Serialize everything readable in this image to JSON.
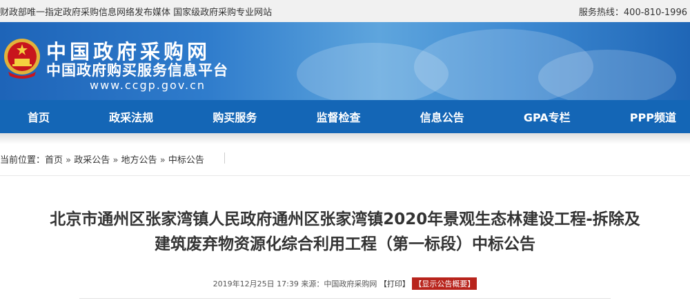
{
  "topbar": {
    "left_text": "财政部唯一指定政府采购信息网络发布媒体 国家级政府采购专业网站",
    "hotline": "服务热线：400-810-1996"
  },
  "brand": {
    "name": "中国政府采购网",
    "subtitle": "中国政府购买服务信息平台",
    "url": "www.ccgp.gov.cn"
  },
  "nav": {
    "items": [
      "首页",
      "政采法规",
      "购买服务",
      "监督检查",
      "信息公告",
      "GPA专栏",
      "PPP频道"
    ]
  },
  "breadcrumb": {
    "prefix": "当前位置：",
    "items": [
      "首页",
      "政采公告",
      "地方公告",
      "中标公告"
    ],
    "separator": "»"
  },
  "article": {
    "title_line1": "北京市通州区张家湾镇人民政府通州区张家湾镇2020年景观生态林建设工程-拆除及",
    "title_line2": "建筑废弃物资源化综合利用工程（第一标段）中标公告",
    "date": "2019年12月25日 17:39",
    "source": "来源：中国政府采购网",
    "print_label": "【打印】",
    "summary_label": "【显示公告概要】"
  },
  "colors": {
    "nav_bg": "#1466b6",
    "banner": "#2f7ccc",
    "badge": "#b8241c"
  }
}
